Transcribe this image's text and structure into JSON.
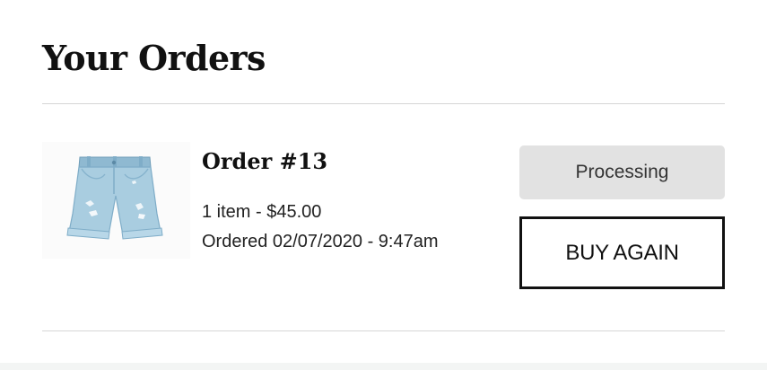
{
  "page": {
    "title": "Your Orders"
  },
  "orders": [
    {
      "title": "Order #13",
      "summary": "1 item - $45.00",
      "ordered": "Ordered 02/07/2020 - 9:47am",
      "status": "Processing",
      "action_label": "BUY AGAIN",
      "thumbnail": "denim-shorts-image"
    }
  ],
  "colors": {
    "status_bg": "#e2e2e2",
    "divider": "#d6d6d6",
    "denim": "#a9cde0"
  }
}
